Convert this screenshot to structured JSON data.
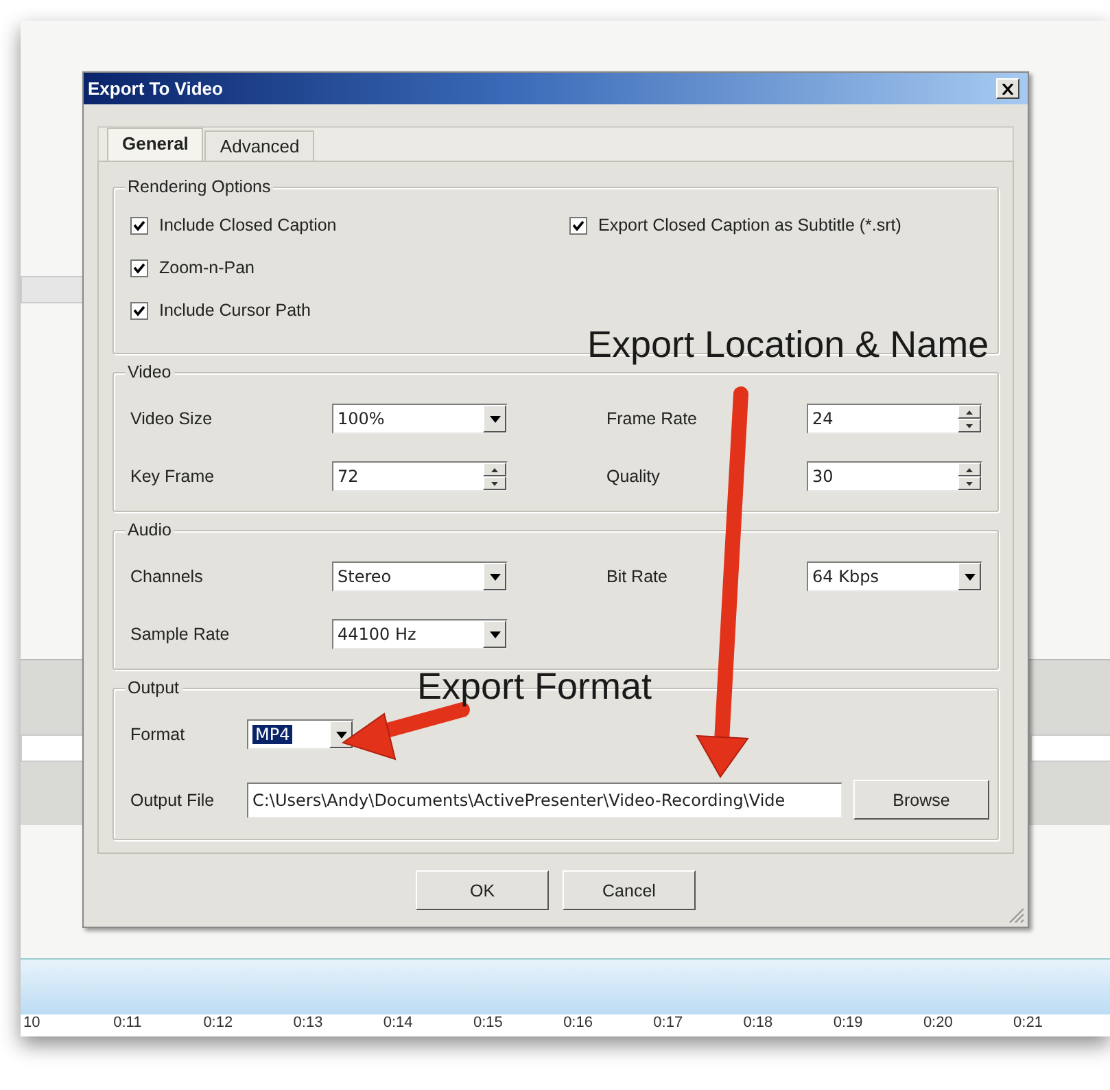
{
  "window": {
    "title": "Export To Video"
  },
  "tabs": [
    {
      "label": "General",
      "selected": true
    },
    {
      "label": "Advanced",
      "selected": false
    }
  ],
  "rendering_options": {
    "title": "Rendering Options",
    "left": [
      {
        "label": "Include Closed Caption",
        "checked": true
      },
      {
        "label": "Zoom-n-Pan",
        "checked": true
      },
      {
        "label": "Include Cursor Path",
        "checked": true
      }
    ],
    "right": [
      {
        "label": "Export Closed Caption as Subtitle (*.srt)",
        "checked": true
      }
    ]
  },
  "video": {
    "title": "Video",
    "fields": [
      {
        "label": "Video Size",
        "kind": "dropdown",
        "value": "100%"
      },
      {
        "label": "Frame Rate",
        "kind": "spinner",
        "value": "24"
      },
      {
        "label": "Key Frame",
        "kind": "spinner",
        "value": "72"
      },
      {
        "label": "Quality",
        "kind": "spinner",
        "value": "30"
      }
    ]
  },
  "audio": {
    "title": "Audio",
    "fields": [
      {
        "label": "Channels",
        "kind": "dropdown",
        "value": "Stereo"
      },
      {
        "label": "Bit Rate",
        "kind": "dropdown",
        "value": "64 Kbps"
      },
      {
        "label": "Sample Rate",
        "kind": "dropdown",
        "value": "44100 Hz"
      }
    ]
  },
  "output": {
    "title": "Output",
    "format": {
      "label": "Format",
      "value": "MP4",
      "selected": true
    },
    "output_file": {
      "label": "Output File",
      "value": "C:\\Users\\Andy\\Documents\\ActivePresenter\\Video-Recording\\Vide"
    },
    "browse": "Browse"
  },
  "buttons": [
    "OK",
    "Cancel"
  ],
  "annotations": [
    {
      "text": "Export Location & Name"
    },
    {
      "text": "Export Format"
    }
  ],
  "timeline": {
    "ticks": [
      "10",
      "0:11",
      "0:12",
      "0:13",
      "0:14",
      "0:15",
      "0:16",
      "0:17",
      "0:18",
      "0:19",
      "0:20",
      "0:21"
    ]
  }
}
